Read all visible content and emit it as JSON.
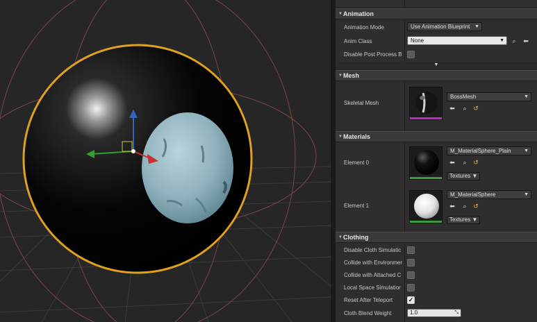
{
  "colors": {
    "viewport_bg": "#262626",
    "panel_bg": "#2b2b2b",
    "category_bg": "#3a3a3a",
    "selection_outline": "#e0a020",
    "axis_x": "#c83232",
    "axis_y": "#32a032",
    "axis_z": "#3264c8",
    "mesh_bar": "#c028c8",
    "material_bar": "#3c9c3c"
  },
  "viewport": {
    "grid": "perspective grid",
    "objects": [
      "black-sphere",
      "light-blue-sphere",
      "transform-gizmo"
    ]
  },
  "details": {
    "animation": {
      "title": "Animation",
      "mode_label": "Animation Mode",
      "mode_value": "Use Animation Blueprint",
      "anim_class_label": "Anim Class",
      "anim_class_value": "None",
      "disable_post_label": "Disable Post Process B",
      "disable_post_checked": false,
      "expander_glyph": "▼"
    },
    "mesh": {
      "title": "Mesh",
      "skeletal_label": "Skeletal Mesh",
      "skeletal_value": "BossMesh"
    },
    "materials": {
      "title": "Materials",
      "elements": [
        {
          "label": "Element 0",
          "value": "M_MaterialSphere_Plain",
          "textures": "Textures"
        },
        {
          "label": "Element 1",
          "value": "M_MaterialSphere",
          "textures": "Textures"
        }
      ]
    },
    "clothing": {
      "title": "Clothing",
      "rows": [
        {
          "label": "Disable Cloth Simulatic",
          "checked": false
        },
        {
          "label": "Collide with Environmer",
          "checked": false
        },
        {
          "label": "Collide with Attached C",
          "checked": false
        },
        {
          "label": "Local Space Simulatior",
          "checked": false
        },
        {
          "label": "Reset After Teleport",
          "checked": true
        }
      ],
      "blend_label": "Cloth Blend Weight",
      "blend_value": "1.0"
    }
  },
  "icons": {
    "browse": "search-icon",
    "use": "arrow-left-icon",
    "reset": "reset-icon",
    "dropdown": "chevron-down-icon",
    "collapse": "triangle-down-icon"
  }
}
